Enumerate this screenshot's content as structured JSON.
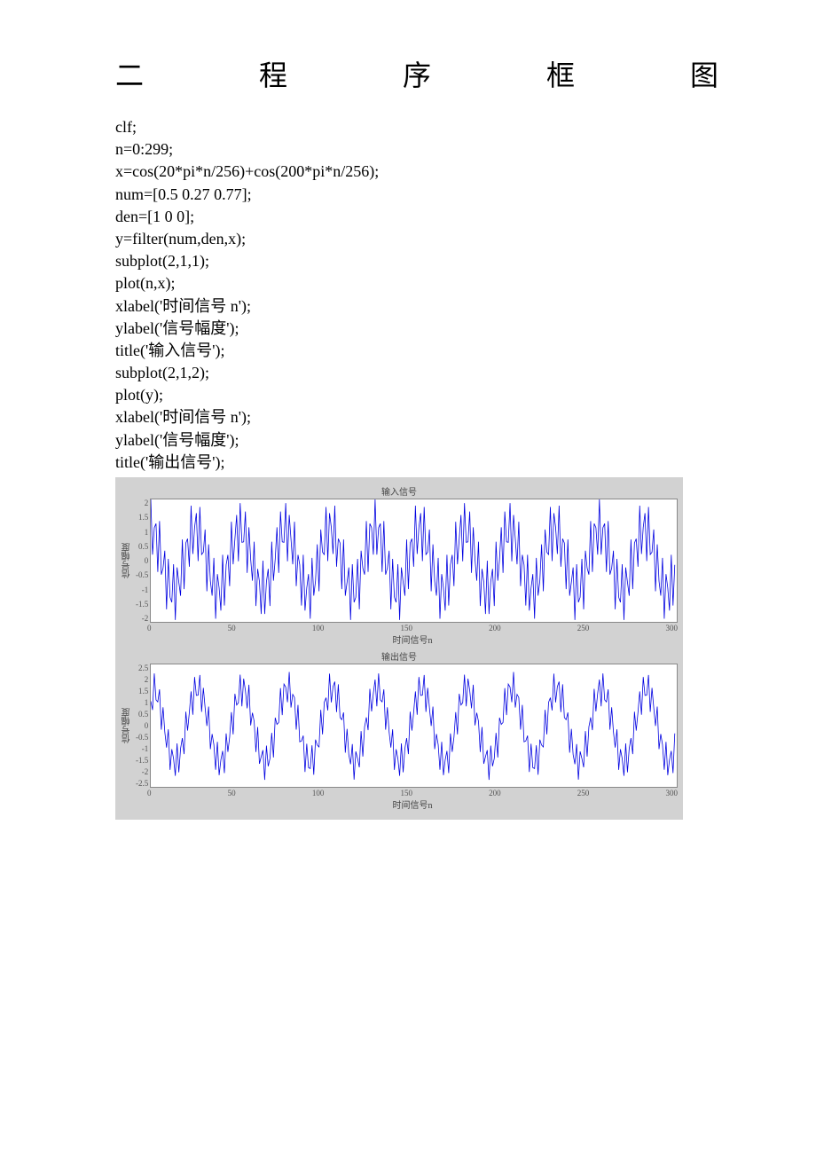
{
  "heading": {
    "c1": "二",
    "c2": "程",
    "c3": "序",
    "c4": "框",
    "c5": "图"
  },
  "code": {
    "l1": "clf;",
    "l2": "n=0:299;",
    "l3": "x=cos(20*pi*n/256)+cos(200*pi*n/256);",
    "l4": "num=[0.5 0.27 0.77];",
    "l5": "den=[1 0 0];",
    "l6": "y=filter(num,den,x);",
    "l7": "subplot(2,1,1);",
    "l8": "plot(n,x);",
    "l9a": "xlabel('",
    "l9b": "时间信号",
    "l9c": " n');",
    "l10a": "ylabel('",
    "l10b": "信号幅度",
    "l10c": "');",
    "l11a": "title('",
    "l11b": "输入信号",
    "l11c": "');",
    "l12": "subplot(2,1,2);",
    "l13": "plot(y);",
    "l14a": "xlabel('",
    "l14b": "时间信号",
    "l14c": " n');",
    "l15a": "ylabel('",
    "l15b": "信号幅度",
    "l15c": "');",
    "l16a": "title('",
    "l16b": "输出信号",
    "l16c": "');"
  },
  "chart_data": [
    {
      "type": "line",
      "title": "输入信号",
      "xlabel": "时间信号n",
      "ylabel": "信号幅度",
      "xlim": [
        0,
        300
      ],
      "ylim": [
        -2,
        2
      ],
      "xticks": [
        0,
        50,
        100,
        150,
        200,
        250,
        300
      ],
      "yticks": [
        -2,
        -1.5,
        -1,
        -0.5,
        0,
        0.5,
        1,
        1.5,
        2
      ],
      "series": [
        {
          "name": "x",
          "expr": "cos(20*pi*n/256)+cos(200*pi*n/256)",
          "n_range": "0:299"
        }
      ]
    },
    {
      "type": "line",
      "title": "输出信号",
      "xlabel": "时间信号n",
      "ylabel": "信号幅度",
      "xlim": [
        0,
        300
      ],
      "ylim": [
        -2.5,
        2.5
      ],
      "xticks": [
        0,
        50,
        100,
        150,
        200,
        250,
        300
      ],
      "yticks": [
        -2.5,
        -2,
        -1.5,
        -1,
        -0.5,
        0,
        0.5,
        1,
        1.5,
        2,
        2.5
      ],
      "series": [
        {
          "name": "y",
          "expr": "filter([0.5,0.27,0.77],[1,0,0],x)",
          "n_range": "0:299"
        }
      ]
    }
  ]
}
